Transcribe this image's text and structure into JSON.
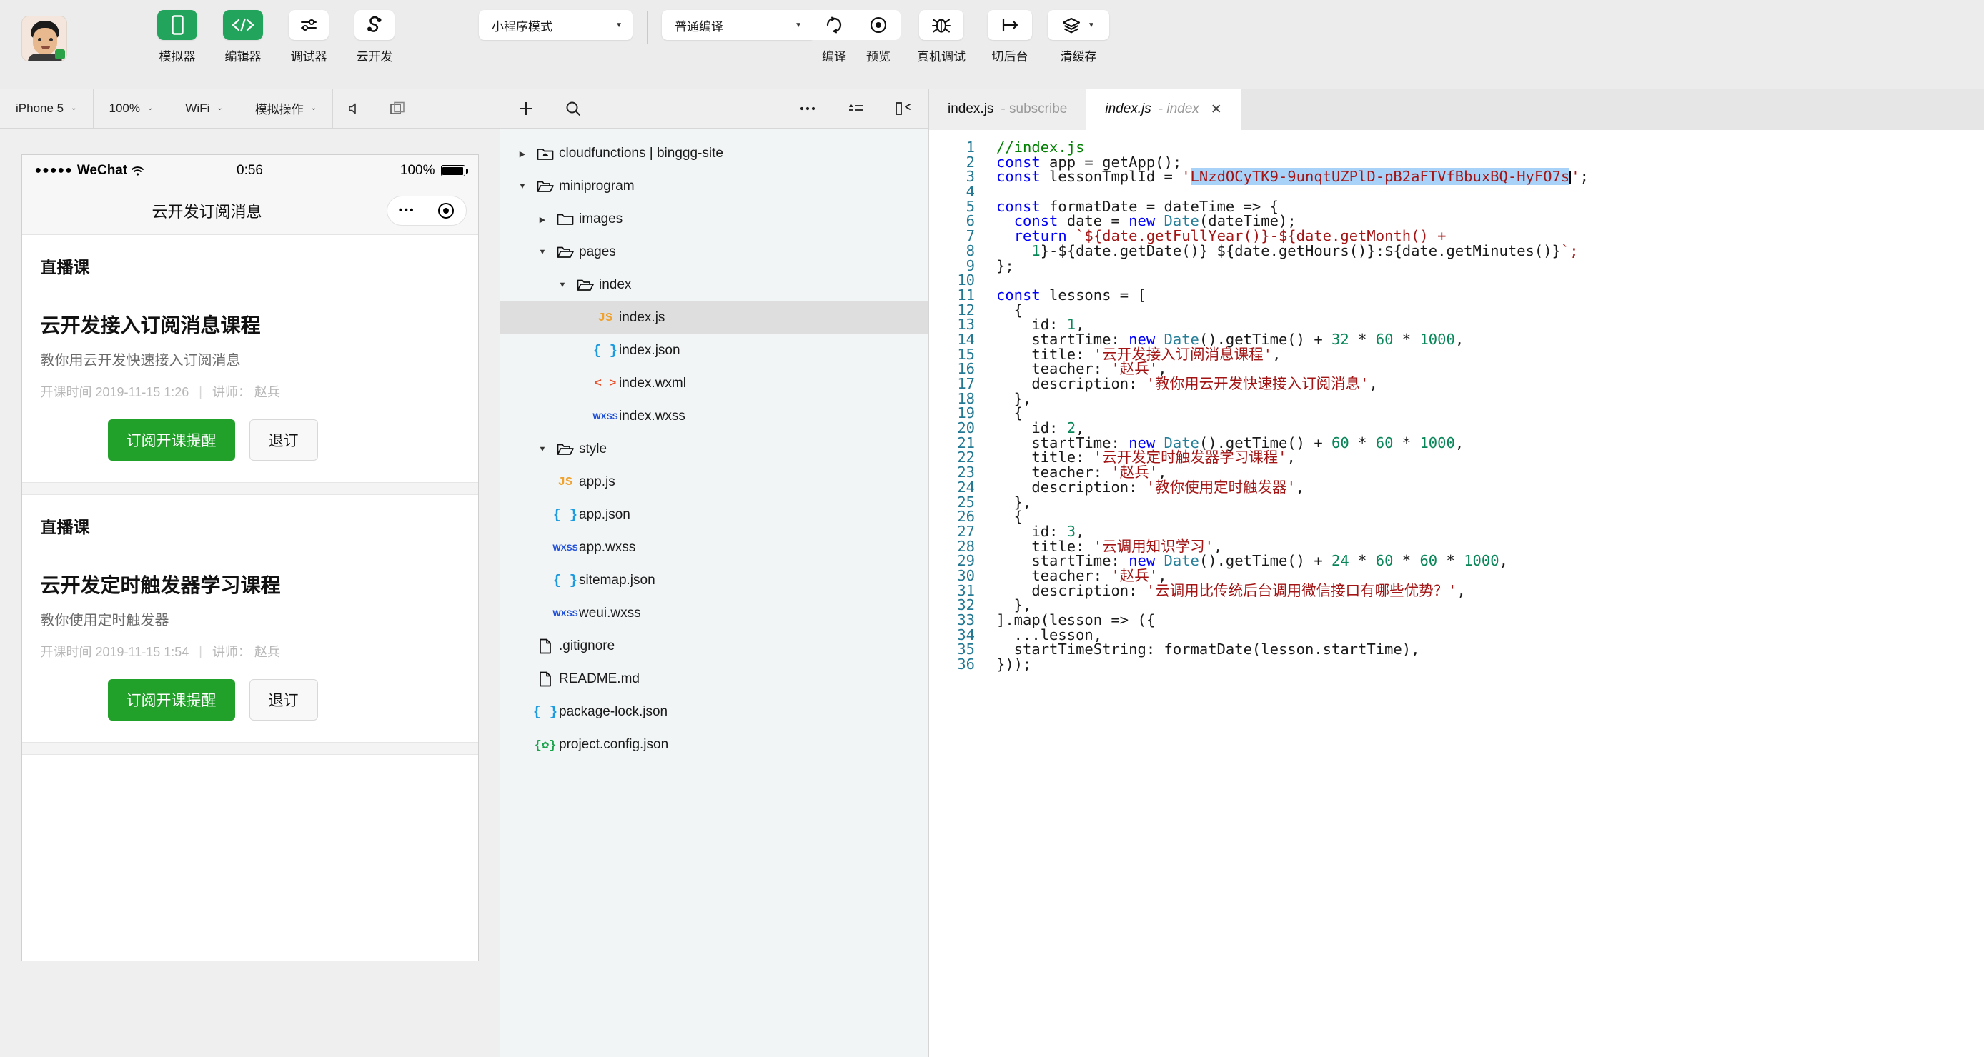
{
  "toolbar": {
    "avatar_name": "user-avatar",
    "buttons": [
      {
        "label": "模拟器",
        "icon": "phone-icon",
        "active": true
      },
      {
        "label": "编辑器",
        "icon": "code-icon",
        "active": true
      },
      {
        "label": "调试器",
        "icon": "debugger-icon",
        "active": false
      },
      {
        "label": "云开发",
        "icon": "cloud-dev-icon",
        "active": false
      }
    ],
    "mode_select": "小程序模式",
    "compile_select": "普通编译",
    "compile_label": "编译",
    "preview_label": "预览",
    "realdevice_label": "真机调试",
    "background_label": "切后台",
    "cache_label": "清缓存"
  },
  "simulator_bar": {
    "device": "iPhone 5",
    "zoom": "100%",
    "network": "WiFi",
    "simulate": "模拟操作",
    "chevron": "⌄"
  },
  "phone": {
    "status": {
      "carrier": "WeChat",
      "dots": "●●●●●",
      "time": "0:56",
      "battery_pct": "100%"
    },
    "nav_title": "云开发订阅消息",
    "cards": [
      {
        "head": "直播课",
        "title": "云开发接入订阅消息课程",
        "desc": "教你用云开发快速接入订阅消息",
        "meta_time": "开课时间 2019-11-15 1:26",
        "meta_sep": "|",
        "meta_teacher": "讲师： 赵兵",
        "subscribe": "订阅开课提醒",
        "unsubscribe": "退订"
      },
      {
        "head": "直播课",
        "title": "云开发定时触发器学习课程",
        "desc": "教你使用定时触发器",
        "meta_time": "开课时间 2019-11-15 1:54",
        "meta_sep": "|",
        "meta_teacher": "讲师： 赵兵",
        "subscribe": "订阅开课提醒",
        "unsubscribe": "退订"
      }
    ]
  },
  "tree": {
    "toolbar_icons": [
      "plus-icon",
      "search-icon",
      "more-icon",
      "collapse-all-icon",
      "panel-collapse-icon"
    ],
    "items": [
      {
        "label": "cloudfunctions | binggg-site",
        "indent": 0,
        "type": "folder-cloud",
        "arrow": "▶",
        "selected": false
      },
      {
        "label": "miniprogram",
        "indent": 0,
        "type": "folder-open",
        "arrow": "▼",
        "selected": false
      },
      {
        "label": "images",
        "indent": 1,
        "type": "folder",
        "arrow": "▶",
        "selected": false
      },
      {
        "label": "pages",
        "indent": 1,
        "type": "folder-open",
        "arrow": "▼",
        "selected": false
      },
      {
        "label": "index",
        "indent": 2,
        "type": "folder-open",
        "arrow": "▼",
        "selected": false
      },
      {
        "label": "index.js",
        "indent": 3,
        "type": "js",
        "arrow": "",
        "selected": true
      },
      {
        "label": "index.json",
        "indent": 3,
        "type": "json",
        "arrow": "",
        "selected": false
      },
      {
        "label": "index.wxml",
        "indent": 3,
        "type": "wxml",
        "arrow": "",
        "selected": false
      },
      {
        "label": "index.wxss",
        "indent": 3,
        "type": "wxss",
        "arrow": "",
        "selected": false
      },
      {
        "label": "style",
        "indent": 1,
        "type": "folder-open",
        "arrow": "▼",
        "selected": false
      },
      {
        "label": "app.js",
        "indent": 1,
        "type": "js",
        "arrow": "",
        "selected": false
      },
      {
        "label": "app.json",
        "indent": 1,
        "type": "json",
        "arrow": "",
        "selected": false
      },
      {
        "label": "app.wxss",
        "indent": 1,
        "type": "wxss",
        "arrow": "",
        "selected": false
      },
      {
        "label": "sitemap.json",
        "indent": 1,
        "type": "json",
        "arrow": "",
        "selected": false
      },
      {
        "label": "weui.wxss",
        "indent": 1,
        "type": "wxss",
        "arrow": "",
        "selected": false
      },
      {
        "label": ".gitignore",
        "indent": 0,
        "type": "file",
        "arrow": "",
        "selected": false
      },
      {
        "label": "README.md",
        "indent": 0,
        "type": "file",
        "arrow": "",
        "selected": false
      },
      {
        "label": "package-lock.json",
        "indent": 0,
        "type": "json",
        "arrow": "",
        "selected": false
      },
      {
        "label": "project.config.json",
        "indent": 0,
        "type": "config",
        "arrow": "",
        "selected": false
      }
    ]
  },
  "editor": {
    "tabs": [
      {
        "name": "index.js",
        "suffix": "- subscribe",
        "active": false,
        "italic": false,
        "closable": false
      },
      {
        "name": "index.js",
        "suffix": "- index",
        "active": true,
        "italic": true,
        "closable": true,
        "close": "✕"
      }
    ],
    "first_line": 1,
    "last_line": 36,
    "selected_template_id": "LNzdOCyTK9-9unqtUZPlD-pB2aFTVfBbuxBQ-HyFO7s",
    "code_lines": [
      "//index.js",
      "const app = getApp();",
      "const lessonTmplId = 'LNzdOCyTK9-9unqtUZPlD-pB2aFTVfBbuxBQ-HyFO7s';",
      "",
      "const formatDate = dateTime => {",
      "  const date = new Date(dateTime);",
      "  return `${date.getFullYear()}-${date.getMonth() +",
      "    1}-${date.getDate()} ${date.getHours()}:${date.getMinutes()}`;",
      "};",
      "",
      "const lessons = [",
      "  {",
      "    id: 1,",
      "    startTime: new Date().getTime() + 32 * 60 * 1000,",
      "    title: '云开发接入订阅消息课程',",
      "    teacher: '赵兵',",
      "    description: '教你用云开发快速接入订阅消息',",
      "  },",
      "  {",
      "    id: 2,",
      "    startTime: new Date().getTime() + 60 * 60 * 1000,",
      "    title: '云开发定时触发器学习课程',",
      "    teacher: '赵兵',",
      "    description: '教你使用定时触发器',",
      "  },",
      "  {",
      "    id: 3,",
      "    title: '云调用知识学习',",
      "    startTime: new Date().getTime() + 24 * 60 * 60 * 1000,",
      "    teacher: '赵兵',",
      "    description: '云调用比传统后台调用微信接口有哪些优势？',",
      "  },",
      "].map(lesson => ({",
      "  ...lesson,",
      "  startTimeString: formatDate(lesson.startTime),",
      "}));"
    ]
  },
  "colors": {
    "brand_green": "#22a45d",
    "button_green": "#21a02a",
    "keyword_blue": "#0000ff",
    "string_red": "#a31515",
    "comment_green": "#008000",
    "number_green": "#098658",
    "type_teal": "#267f99",
    "selection_blue": "#a8d2f8",
    "gutter_blue": "#237893"
  }
}
